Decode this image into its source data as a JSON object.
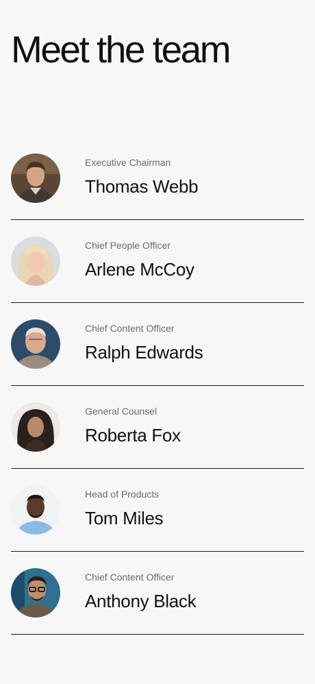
{
  "page": {
    "title": "Meet the team"
  },
  "team": [
    {
      "role": "Executive Chairman",
      "name": "Thomas Webb"
    },
    {
      "role": "Chief People Officer",
      "name": "Arlene McCoy"
    },
    {
      "role": "Chief Content Officer",
      "name": "Ralph Edwards"
    },
    {
      "role": "General Counsel",
      "name": "Roberta Fox"
    },
    {
      "role": "Head of Products",
      "name": "Tom Miles"
    },
    {
      "role": "Chief Content Officer",
      "name": "Anthony Black"
    }
  ]
}
